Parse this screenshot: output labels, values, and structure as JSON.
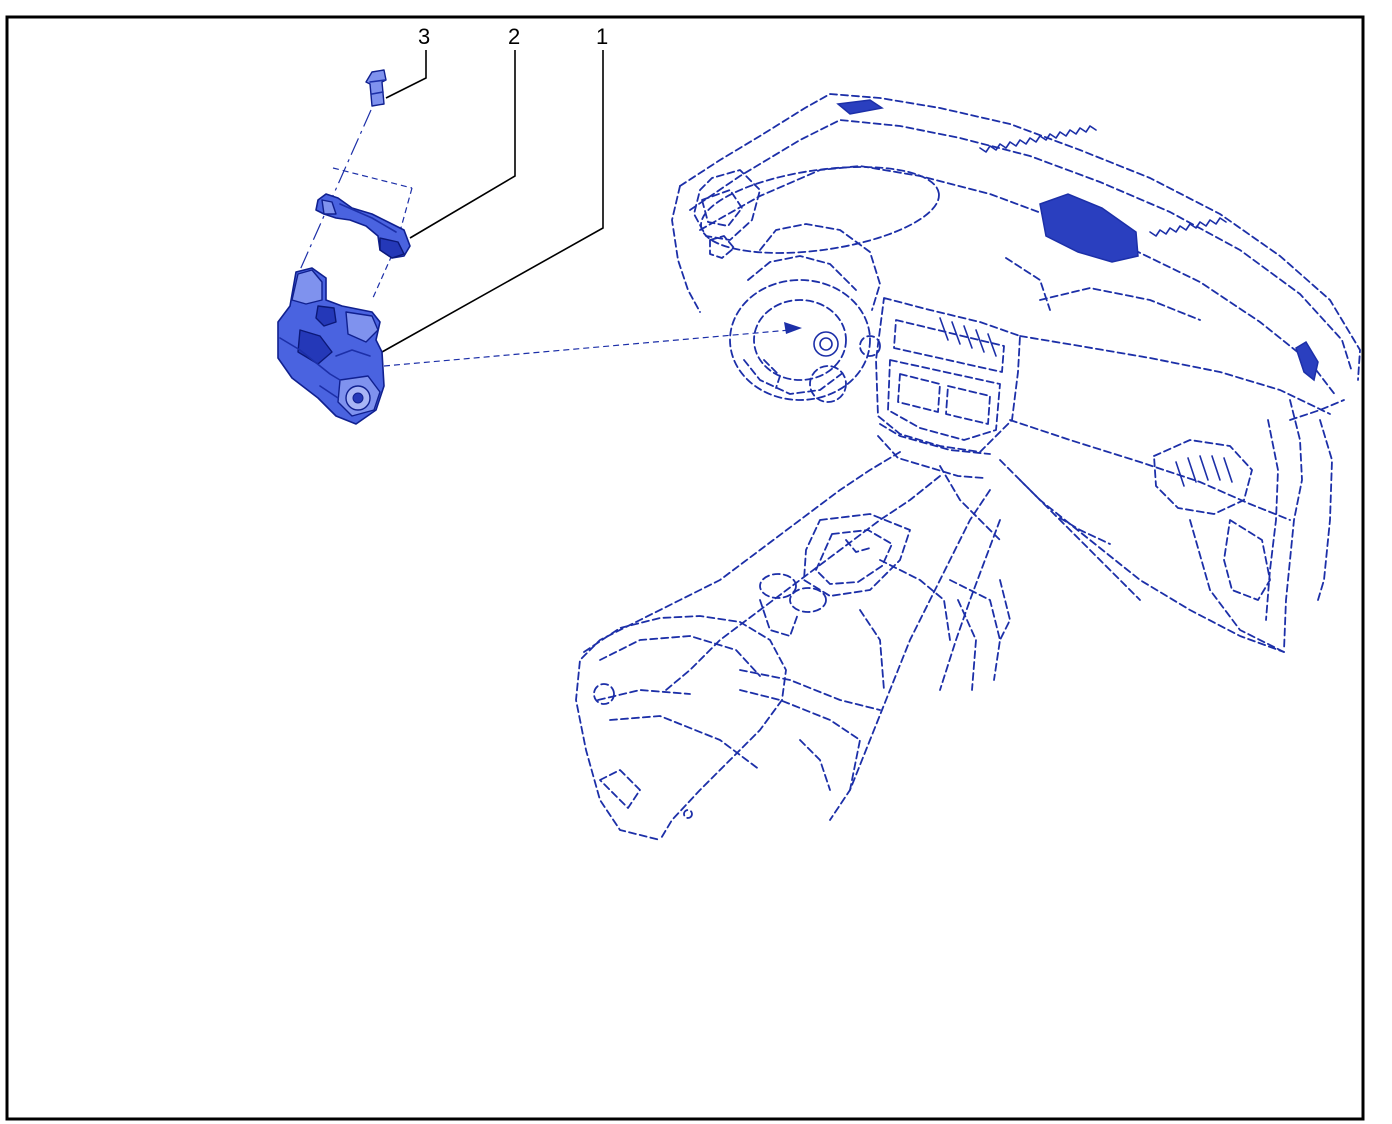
{
  "diagram": {
    "callouts": [
      {
        "id": "callout-1",
        "label": "1"
      },
      {
        "id": "callout-2",
        "label": "2"
      },
      {
        "id": "callout-3",
        "label": "3"
      }
    ]
  },
  "colors": {
    "line": "#1c2fa8",
    "part_fill": "#4a63e0",
    "frame": "#000000"
  }
}
